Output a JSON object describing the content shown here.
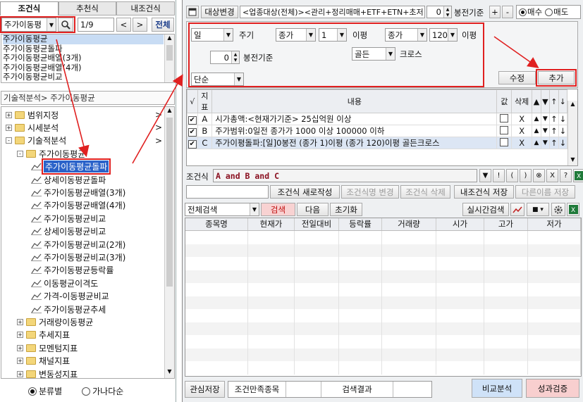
{
  "left_tabs": [
    "조건식",
    "추천식",
    "내조건식"
  ],
  "search": {
    "value": "주가이동평",
    "page": "1/9",
    "all_label": "전체"
  },
  "result_list": [
    "주가이동평균",
    "주가이동평균돌파",
    "주가이동평균배열(3개)",
    "주가이동평균배열(4개)",
    "주가이동평균비교",
    "주가이동평균비교(2개)"
  ],
  "path": "기술적분석> 주가이동평균",
  "tree": [
    {
      "label": "범위지정",
      "level": 0,
      "type": "folder",
      "sign": "+",
      "arrow": ">"
    },
    {
      "label": "시세분석",
      "level": 0,
      "type": "folder",
      "sign": "+",
      "arrow": ">"
    },
    {
      "label": "기술적분석",
      "level": 0,
      "type": "folder",
      "sign": "-",
      "arrow": ">"
    },
    {
      "label": "주가이동평균",
      "level": 1,
      "type": "folder",
      "sign": "-",
      "arrow": ""
    },
    {
      "label": "주가이동평균돌파",
      "level": 2,
      "type": "item",
      "selected": true
    },
    {
      "label": "상세이동평균돌파",
      "level": 2,
      "type": "item"
    },
    {
      "label": "주가이동평균배열(3개)",
      "level": 2,
      "type": "item"
    },
    {
      "label": "주가이동평균배열(4개)",
      "level": 2,
      "type": "item"
    },
    {
      "label": "주가이동평균비교",
      "level": 2,
      "type": "item"
    },
    {
      "label": "상세이동평균비교",
      "level": 2,
      "type": "item"
    },
    {
      "label": "주가이동평균비교(2개)",
      "level": 2,
      "type": "item"
    },
    {
      "label": "주가이동평균비교(3개)",
      "level": 2,
      "type": "item"
    },
    {
      "label": "주가이동평균등락률",
      "level": 2,
      "type": "item"
    },
    {
      "label": "이동평균이격도",
      "level": 2,
      "type": "item"
    },
    {
      "label": "가격-이동평균비교",
      "level": 2,
      "type": "item"
    },
    {
      "label": "주가이동평균추세",
      "level": 2,
      "type": "item"
    },
    {
      "label": "거래량이동평균",
      "level": 1,
      "type": "folder",
      "sign": "+",
      "arrow": ""
    },
    {
      "label": "추세지표",
      "level": 1,
      "type": "folder",
      "sign": "+",
      "arrow": ""
    },
    {
      "label": "모멘텀지표",
      "level": 1,
      "type": "folder",
      "sign": "+",
      "arrow": ""
    },
    {
      "label": "채널지표",
      "level": 1,
      "type": "folder",
      "sign": "+",
      "arrow": ""
    },
    {
      "label": "변동성지표",
      "level": 1,
      "type": "folder",
      "sign": "+",
      "arrow": ""
    },
    {
      "label": "거래량지표",
      "level": 1,
      "type": "folder",
      "sign": "+",
      "arrow": ""
    }
  ],
  "radio_group": [
    "분류별",
    "가나다순"
  ],
  "top": {
    "target_btn": "대상변경",
    "target_text": "<업종대상(전체)><관리+정리매매+ETF+ETN+초저",
    "zero": "0",
    "base_label": "봉전기준",
    "plus": "+",
    "minus": "-",
    "buy": "매수",
    "sell": "매도"
  },
  "params": {
    "period": "일",
    "period_label": "주기",
    "offset": "0",
    "offset_label": "봉전기준",
    "field1": "종가",
    "n1": "1",
    "avg_label1": "이평",
    "field2": "종가",
    "n2": "120",
    "avg_label2": "이평",
    "cross": "골든",
    "cross_label": "크로스",
    "avg_type": "단순"
  },
  "edit_btn": "수정",
  "add_btn": "추가",
  "cond_headers": [
    "√",
    "지표",
    "내용",
    "값",
    "삭제",
    "▲",
    "▼",
    "↑",
    "↓"
  ],
  "conditions": [
    {
      "checked": true,
      "id": "A",
      "text": "시가총액:<현재가기준> 25십억원 이상",
      "del": "X"
    },
    {
      "checked": true,
      "id": "B",
      "text": "주가범위:0일전 종가가 1000 이상 100000 이하",
      "del": "X"
    },
    {
      "checked": true,
      "id": "C",
      "text": "주가이평돌파:[일]0봉전 (종가 1)이평 (종가 120)이평 골든크로스",
      "del": "X"
    }
  ],
  "formula_label": "조건식",
  "formula": "A and B and C",
  "formula_btns": [
    "▼",
    "!",
    "(",
    ")",
    "⊗",
    "X",
    "?"
  ],
  "actions": {
    "new": "조건식 새로작성",
    "rename": "조건식명 변경",
    "delete": "조건식 삭제",
    "save": "내조건식 저장",
    "save_as": "다른이름 저장"
  },
  "search_bar": {
    "scope": "전체검색",
    "search": "검색",
    "next": "다음",
    "reset": "초기화",
    "realtime": "실시간검색"
  },
  "result_headers": [
    "종목명",
    "현재가",
    "전일대비",
    "등락률",
    "거래량",
    "시가",
    "고가",
    "저가"
  ],
  "bottom": {
    "fav": "관심저장",
    "count_label": "조건만족종목",
    "result_label": "검색결과",
    "compare": "비교분석",
    "verify": "성과검증"
  }
}
